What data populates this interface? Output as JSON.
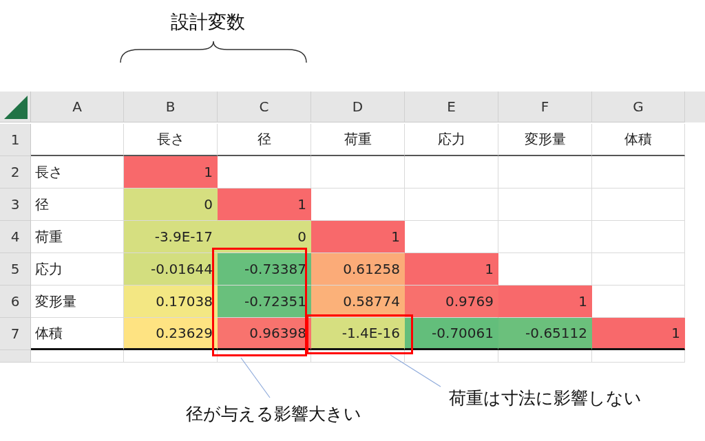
{
  "title": "設計変数",
  "sheet": {
    "columns": [
      "A",
      "B",
      "C",
      "D",
      "E",
      "F",
      "G"
    ],
    "rows": [
      {
        "number": "1",
        "values": [
          {
            "text": "長さ"
          },
          {
            "text": "径"
          },
          {
            "text": "荷重"
          },
          {
            "text": "応力"
          },
          {
            "text": "変形量"
          },
          {
            "text": "体積"
          }
        ]
      },
      {
        "number": "2",
        "label": "長さ",
        "values": [
          {
            "text": "1",
            "color": "#f8696b"
          }
        ]
      },
      {
        "number": "3",
        "label": "径",
        "values": [
          {
            "text": "0",
            "color": "#d6df80"
          },
          {
            "text": "1",
            "color": "#f8696b"
          }
        ]
      },
      {
        "number": "4",
        "label": "荷重",
        "values": [
          {
            "text": "-3.9E-17",
            "color": "#d6df80"
          },
          {
            "text": "0",
            "color": "#d6df80"
          },
          {
            "text": "1",
            "color": "#f8696b"
          }
        ]
      },
      {
        "number": "5",
        "label": "応力",
        "values": [
          {
            "text": "-0.01644",
            "color": "#d3de7f"
          },
          {
            "text": "-0.73387",
            "color": "#66bf7c"
          },
          {
            "text": "0.61258",
            "color": "#fbab78"
          },
          {
            "text": "1",
            "color": "#f8696b"
          }
        ]
      },
      {
        "number": "6",
        "label": "変形量",
        "values": [
          {
            "text": "0.17038",
            "color": "#f3e783"
          },
          {
            "text": "-0.72351",
            "color": "#69c07c"
          },
          {
            "text": "0.58774",
            "color": "#fbb179"
          },
          {
            "text": "0.9769",
            "color": "#f8706d"
          },
          {
            "text": "1",
            "color": "#f8696b"
          }
        ]
      },
      {
        "number": "7",
        "label": "体積",
        "values": [
          {
            "text": "0.23629",
            "color": "#fee382"
          },
          {
            "text": "0.96398",
            "color": "#f8736e"
          },
          {
            "text": "-1.4E-16",
            "color": "#d6df80"
          },
          {
            "text": "-0.70061",
            "color": "#63be7b"
          },
          {
            "text": "-0.65112",
            "color": "#6bc07c"
          },
          {
            "text": "1",
            "color": "#f8696b"
          }
        ]
      }
    ]
  },
  "callouts": [
    {
      "text": "径が与える影響大きい"
    },
    {
      "text": "荷重は寸法に影響しない"
    }
  ]
}
